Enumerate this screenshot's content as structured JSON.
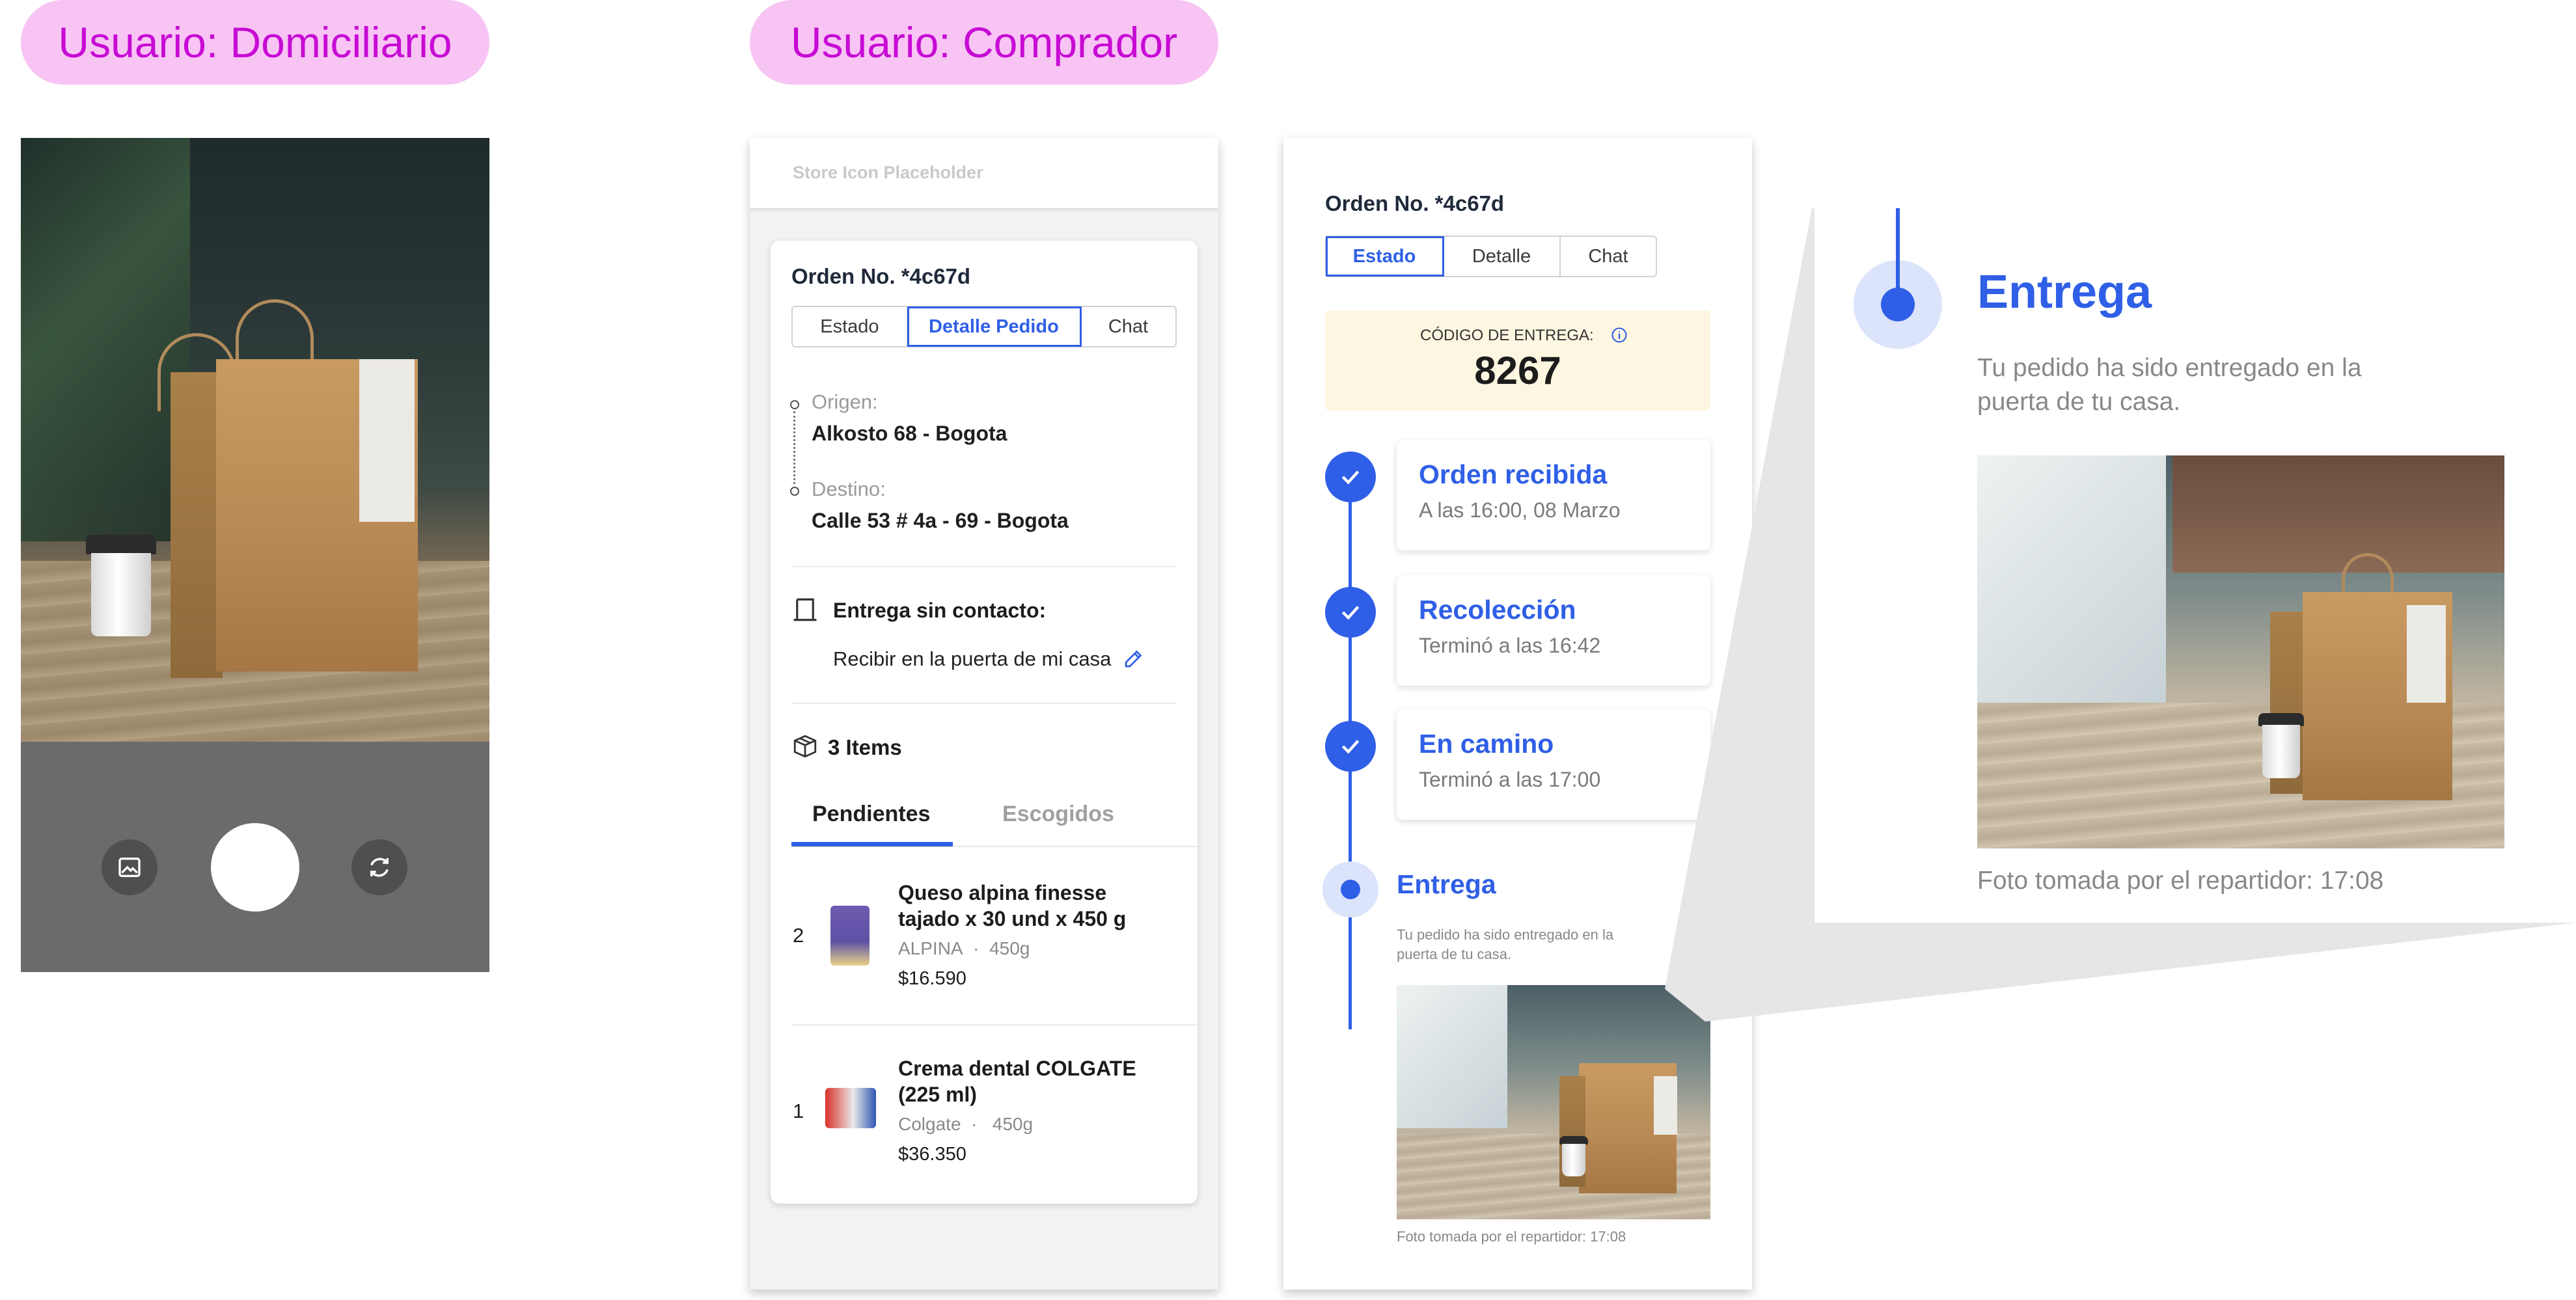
{
  "roles": {
    "courier": "Usuario: Domiciliario",
    "buyer": "Usuario: Comprador"
  },
  "camera": {
    "gallery_icon": "image-icon",
    "switch_icon": "camera-switch-icon"
  },
  "detail_screen": {
    "store_placeholder": "Store Icon Placeholder",
    "order_title": "Orden No. *4c67d",
    "tabs": [
      "Estado",
      "Detalle Pedido",
      "Chat"
    ],
    "active_tab": "Detalle Pedido",
    "origin_label": "Origen:",
    "origin_value": "Alkosto 68 - Bogota",
    "destination_label": "Destino:",
    "destination_value": "Calle 53 # 4a - 69 - Bogota",
    "contactless_label": "Entrega sin contacto:",
    "contactless_value": "Recibir en la puerta de mi casa",
    "items_count": "3 Items",
    "item_tabs": [
      "Pendientes",
      "Escogidos"
    ],
    "active_item_tab": "Pendientes",
    "items": [
      {
        "qty": "2",
        "name_line1": "Queso alpina finesse",
        "name_line2": "tajado x 30 und x 450 g",
        "brand": "ALPINA",
        "sep": "·",
        "weight": "450g",
        "price": "$16.590"
      },
      {
        "qty": "1",
        "name_line1": "Crema dental COLGATE",
        "name_line2": "(225 ml)",
        "brand": "Colgate",
        "sep": "·",
        "weight": "450g",
        "price": "$36.350"
      }
    ]
  },
  "status_screen": {
    "order_title": "Orden No. *4c67d",
    "tabs": [
      "Estado",
      "Detalle",
      "Chat"
    ],
    "active_tab": "Estado",
    "code_label": "CÓDIGO DE ENTREGA:",
    "code_value": "8267",
    "steps": [
      {
        "title": "Orden recibida",
        "subtitle": "A las 16:00, 08 Marzo",
        "done": true
      },
      {
        "title": "Recolección",
        "subtitle": "Terminó a las 16:42",
        "done": true
      },
      {
        "title": "En camino",
        "subtitle": "Terminó a las 17:00",
        "done": true
      }
    ],
    "delivery_title": "Entrega",
    "delivery_line1": "Tu pedido ha sido entregado en la",
    "delivery_line2": "puerta de tu casa.",
    "photo_caption": "Foto tomada por el repartidor: 17:08"
  },
  "zoom": {
    "title": "Entrega",
    "line1": "Tu pedido ha sido entregado en la",
    "line2": "puerta de tu casa.",
    "caption": "Foto tomada por el repartidor: 17:08"
  },
  "colors": {
    "accent": "#2f5fe6",
    "pill_bg": "#f7c4f4",
    "pill_text": "#c70ad4",
    "code_bg": "#fdf7e1"
  }
}
